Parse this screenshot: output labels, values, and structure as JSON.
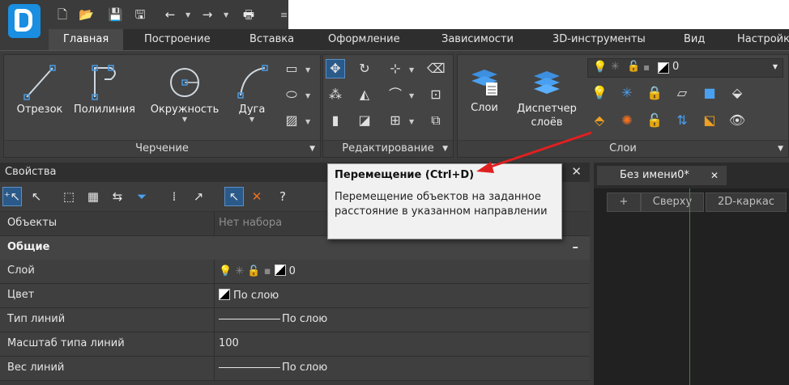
{
  "ribbon_tabs": [
    "Главная",
    "Построение",
    "Вставка",
    "Оформление",
    "Зависимости",
    "3D-инструменты",
    "Вид",
    "Настройк"
  ],
  "drawing_panel": {
    "title": "Черчение",
    "tools": [
      "Отрезок",
      "Полилиния",
      "Окружность",
      "Дуга"
    ]
  },
  "edit_panel": {
    "title": "Редактирование"
  },
  "layers_panel": {
    "title": "Слои",
    "layers_label": "Слои",
    "manager_label": "Диспетчер\nслоёв",
    "current_layer": "0"
  },
  "properties": {
    "title": "Свойства",
    "objects_label": "Объекты",
    "objects_value": "Нет набора",
    "section_general": "Общие",
    "section_toggle": "–",
    "rows": [
      {
        "key": "Слой",
        "value": "0"
      },
      {
        "key": "Цвет",
        "value": "По слою"
      },
      {
        "key": "Тип линий",
        "value": "По слою"
      },
      {
        "key": "Масштаб типа линий",
        "value": "100"
      },
      {
        "key": "Вес линий",
        "value": "По слою"
      }
    ]
  },
  "tooltip": {
    "title": "Перемещение (Ctrl+D)",
    "body": "Перемещение объектов на заданное расстояние в указанном направлении"
  },
  "document": {
    "tab_name": "Без имени0*",
    "close": "✕",
    "view_plus": "+",
    "view_top": "Сверху",
    "view_style": "2D-каркас"
  },
  "colors": {
    "accent_arrow": "#e02020",
    "app_logo": "#1a8ee0",
    "active_tab": "#494949"
  }
}
